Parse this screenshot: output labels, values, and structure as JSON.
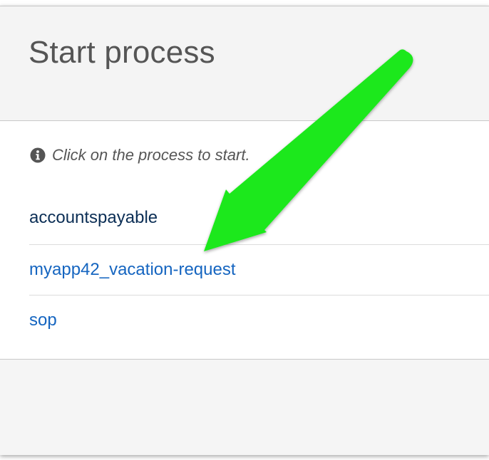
{
  "dialog": {
    "title": "Start process",
    "hint": "Click on the process to start.",
    "hint_icon": "info-circle-icon"
  },
  "processes": [
    {
      "label": "accountspayable"
    },
    {
      "label": "myapp42_vacation-request"
    },
    {
      "label": "sop"
    }
  ],
  "annotation": {
    "type": "arrow",
    "color": "#1ee81e",
    "points_to": "myapp42_vacation-request"
  },
  "colors": {
    "link": "#1565c0",
    "link_active": "#0b2e55",
    "header_bg": "#f4f4f4",
    "title_text": "#555555"
  }
}
